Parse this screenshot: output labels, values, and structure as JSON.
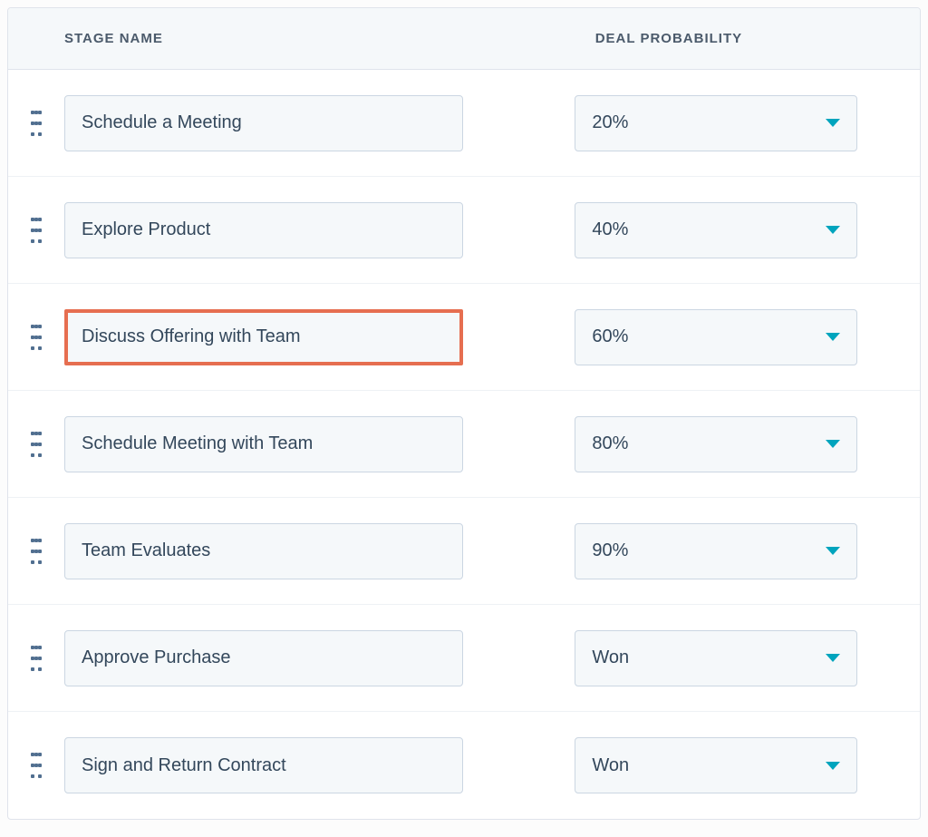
{
  "columns": {
    "stage": "Stage Name",
    "probability": "Deal Probability"
  },
  "stages": [
    {
      "name": "Schedule a Meeting",
      "probability": "20%",
      "highlight": false
    },
    {
      "name": "Explore Product",
      "probability": "40%",
      "highlight": false
    },
    {
      "name": "Discuss Offering with Team",
      "probability": "60%",
      "highlight": true
    },
    {
      "name": "Schedule Meeting with Team",
      "probability": "80%",
      "highlight": false
    },
    {
      "name": "Team Evaluates",
      "probability": "90%",
      "highlight": false
    },
    {
      "name": "Approve Purchase",
      "probability": "Won",
      "highlight": false
    },
    {
      "name": "Sign and Return Contract",
      "probability": "Won",
      "highlight": false
    }
  ]
}
